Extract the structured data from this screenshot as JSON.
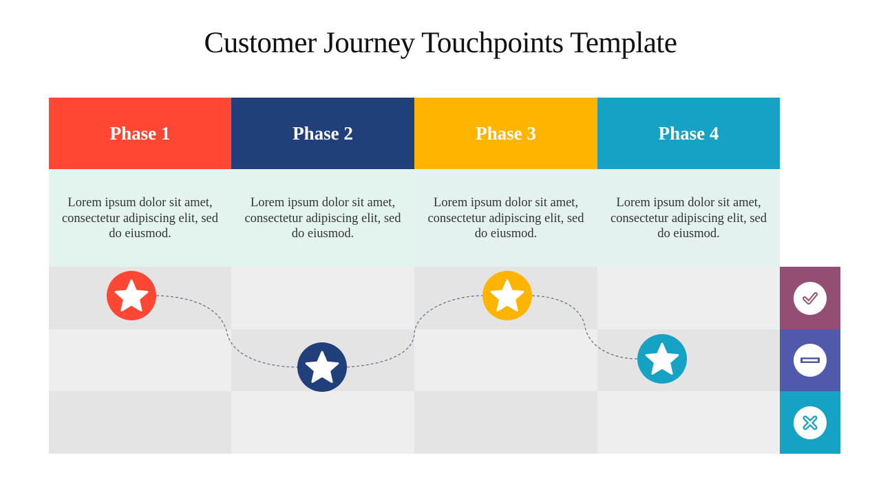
{
  "title": "Customer Journey Touchpoints Template",
  "phases": [
    {
      "label": "Phase 1",
      "color": "#FF4733",
      "text": "Lorem ipsum dolor sit amet, consectetur adipiscing elit, sed do eiusmod.",
      "touchpoint_row": 1
    },
    {
      "label": "Phase 2",
      "color": "#213F7B",
      "text": "Lorem ipsum dolor sit amet, consectetur adipiscing elit, sed do eiusmod.",
      "touchpoint_row": 2
    },
    {
      "label": "Phase 3",
      "color": "#FFB400",
      "text": "Lorem ipsum dolor sit amet, consectetur adipiscing elit, sed do eiusmod.",
      "touchpoint_row": 1
    },
    {
      "label": "Phase 4",
      "color": "#15A2C4",
      "text": "Lorem ipsum dolor sit amet, consectetur adipiscing elit, sed do eiusmod.",
      "touchpoint_row": 2
    }
  ],
  "rating_rows": [
    {
      "icon": "check-icon",
      "color": "#954E73"
    },
    {
      "icon": "minus-icon",
      "color": "#5059AA"
    },
    {
      "icon": "cross-icon",
      "color": "#15A2C4"
    }
  ],
  "colors": {
    "desc_bg_1": "#E3F4EF",
    "desc_bg_2": "#E3F1EF",
    "cell_dark": "#E4E4E4",
    "cell_light": "#EEEEEE",
    "path": "#6B7488"
  }
}
